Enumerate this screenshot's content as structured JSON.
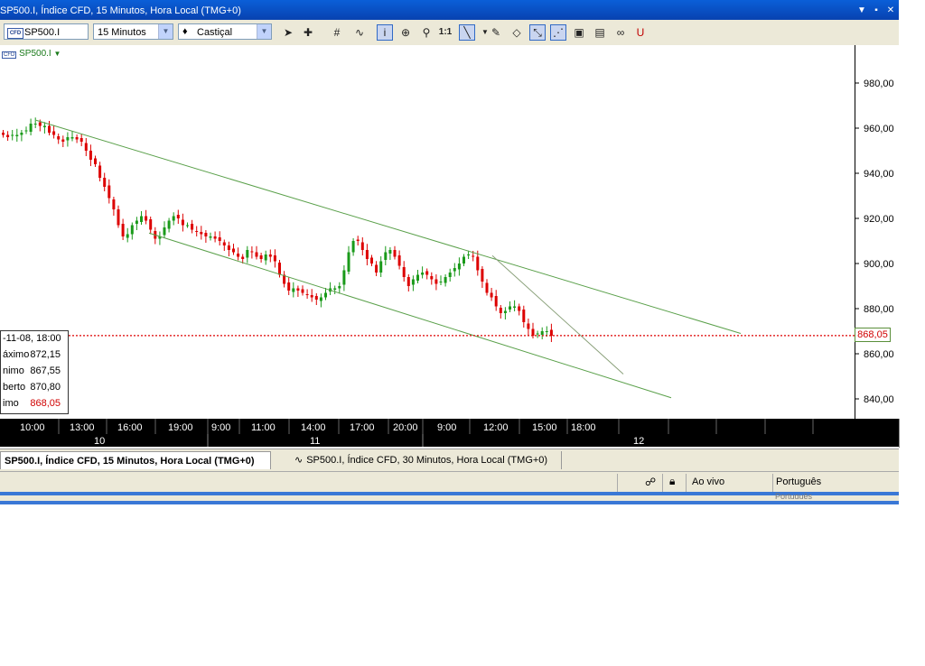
{
  "window": {
    "title": "SP500.I, Índice CFD, 15 Minutos, Hora Local (TMG+0)"
  },
  "toolbar": {
    "symbol": "SP500.I",
    "timeframe": "15 Minutos",
    "chart_style": "Castiçal",
    "ratio_label": "1:1",
    "symbol_badge": "CFD"
  },
  "chart": {
    "symbol_label": "SP500.I",
    "current_price": "868,05",
    "y_ticks": [
      "980,00",
      "960,00",
      "940,00",
      "920,00",
      "900,00",
      "880,00",
      "860,00",
      "840,00"
    ],
    "time_ticks": [
      "10:00",
      "13:00",
      "16:00",
      "19:00",
      "9:00",
      "11:00",
      "14:00",
      "17:00",
      "20:00",
      "9:00",
      "12:00",
      "15:00",
      "18:00"
    ],
    "date_ticks": [
      "10",
      "11",
      "12"
    ],
    "colors": {
      "up": "#1a9a1a",
      "down": "#dd0000",
      "channel": "#5aa04a",
      "price_line": "#dd0000"
    }
  },
  "infobox": {
    "date_row": "-11-08, 18:00",
    "rows": [
      {
        "label": "áximo",
        "value": "872,15"
      },
      {
        "label": "nimo",
        "value": "867,55"
      },
      {
        "label": "berto",
        "value": "870,80"
      },
      {
        "label": "imo",
        "value": "868,05"
      }
    ]
  },
  "tabs": [
    {
      "label": "SP500.I, Índice CFD, 15 Minutos, Hora Local (TMG+0)"
    },
    {
      "label": "SP500.I, Índice CFD, 30 Minutos, Hora Local (TMG+0)"
    }
  ],
  "status": {
    "mode": "Ao vivo",
    "language": "Português",
    "language_ghost": "Português"
  },
  "chart_data": {
    "type": "candlestick",
    "ylim": [
      830,
      992
    ],
    "y_tick_values": [
      980,
      960,
      940,
      920,
      900,
      880,
      860,
      840
    ],
    "current_price": 868.05,
    "closes": [
      957,
      956,
      957,
      957,
      958,
      959,
      962,
      962,
      961,
      961,
      958,
      957,
      955,
      954,
      956,
      956,
      955,
      954,
      950,
      946,
      944,
      938,
      934,
      929,
      924,
      917,
      912,
      913,
      917,
      919,
      921,
      919,
      915,
      911,
      912,
      916,
      919,
      921,
      920,
      917,
      917,
      915,
      914,
      913,
      912,
      912,
      911,
      910,
      908,
      906,
      905,
      903,
      902,
      906,
      905,
      903,
      902,
      904,
      903,
      901,
      895,
      891,
      888,
      889,
      888,
      887,
      886,
      885,
      884,
      885,
      887,
      889,
      889,
      890,
      897,
      905,
      910,
      910,
      906,
      902,
      900,
      896,
      901,
      905,
      906,
      903,
      899,
      894,
      890,
      893,
      895,
      896,
      895,
      893,
      891,
      892,
      894,
      896,
      898,
      900,
      903,
      904,
      903,
      897,
      892,
      887,
      885,
      881,
      878,
      879,
      881,
      881,
      879,
      874,
      871,
      868,
      869,
      870,
      870,
      868
    ]
  }
}
